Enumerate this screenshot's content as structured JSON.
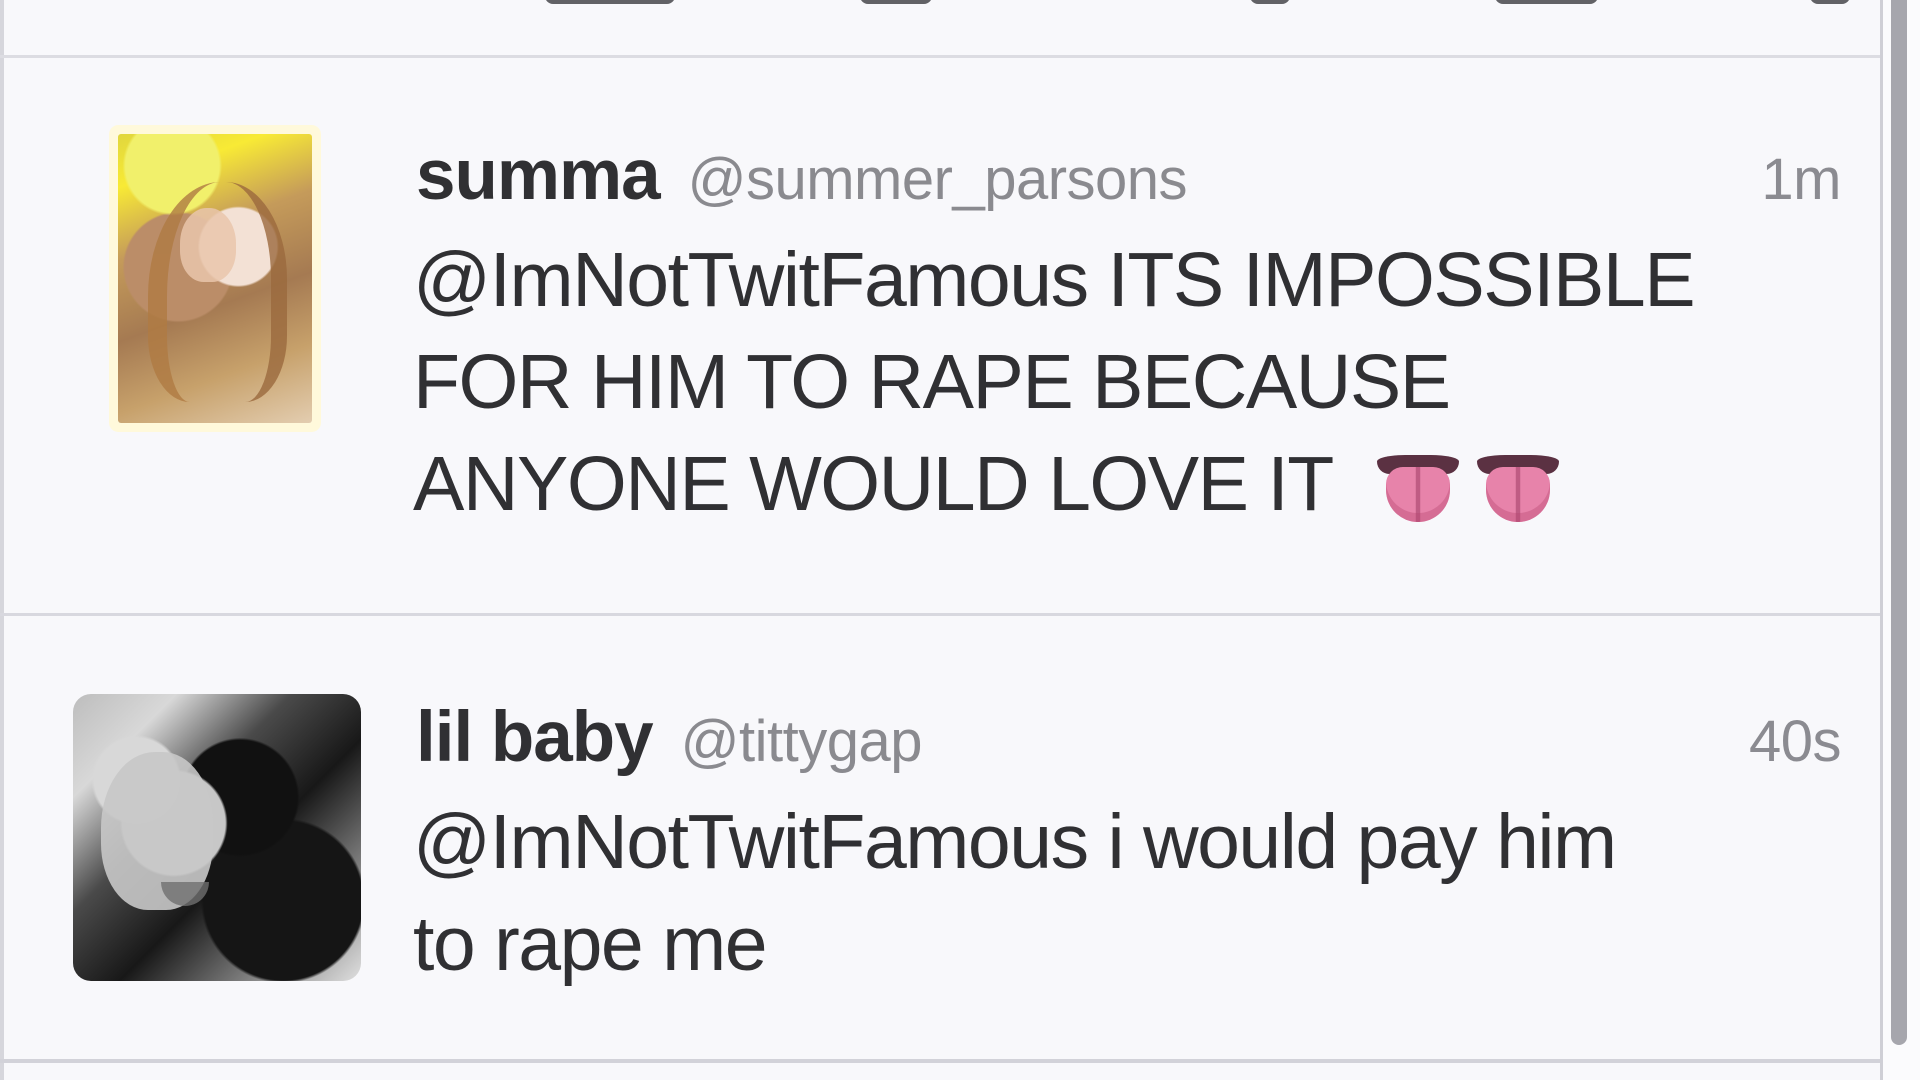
{
  "tweets": [
    {
      "display_name": "summa",
      "handle": "@summer_parsons",
      "time": "1m",
      "text_lines": [
        "@ImNotTwitFamous ITS IMPOSSIBLE",
        "FOR HIM TO RAPE BECAUSE",
        "ANYONE WOULD LOVE IT"
      ],
      "emoji_icons": [
        "tongue-emoji",
        "tongue-emoji"
      ]
    },
    {
      "display_name": "lil baby",
      "handle": "@tittygap",
      "time": "40s",
      "text_lines": [
        "@ImNotTwitFamous i would pay him",
        "to rape me"
      ]
    }
  ],
  "colors": {
    "background": "#f8f8fb",
    "primary_text": "#303033",
    "secondary_text": "#8a8a8f",
    "divider": "#d8d8df",
    "emoji_pink": "#e783aa"
  }
}
